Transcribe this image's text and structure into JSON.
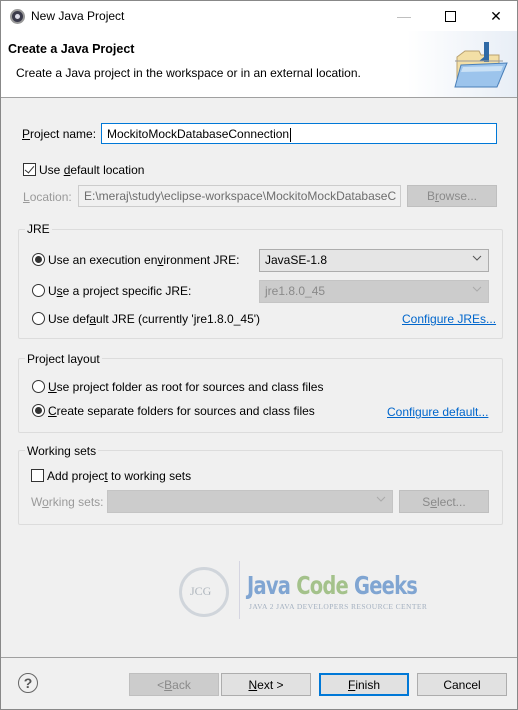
{
  "window": {
    "title": "New Java Project",
    "controls": {
      "minimize": "—",
      "maximize": "",
      "close": "✕"
    }
  },
  "header": {
    "title": "Create a Java Project",
    "description": "Create a Java project in the workspace or in an external location."
  },
  "project_name": {
    "label_prefix": "",
    "label_mnemonic": "P",
    "label_rest": "roject name:",
    "value": "MockitoMockDatabaseConnection"
  },
  "use_default_location": {
    "checked": true,
    "label_pre": "Use ",
    "label_mnemonic": "d",
    "label_rest": "efault location"
  },
  "location": {
    "label_mnemonic": "L",
    "label_rest": "ocation:",
    "value": "E:\\meraj\\study\\eclipse-workspace\\MockitoMockDatabaseC",
    "browse_pre": "B",
    "browse_mnemonic": "r",
    "browse_rest": "owse..."
  },
  "jre": {
    "group_label": "JRE",
    "options": [
      {
        "pre": "Use an execution en",
        "mnemonic": "v",
        "rest": "ironment JRE:",
        "selected": true
      },
      {
        "pre": "U",
        "mnemonic": "s",
        "rest": "e a project specific JRE:",
        "selected": false
      },
      {
        "pre": "Use def",
        "mnemonic": "a",
        "rest": "ult JRE (currently 'jre1.8.0_45')",
        "selected": false
      }
    ],
    "execution_env_value": "JavaSE-1.8",
    "project_jre_value": "jre1.8.0_45",
    "configure_link": "Configure JREs..."
  },
  "project_layout": {
    "group_label": "Project layout",
    "options": [
      {
        "mnemonic": "U",
        "rest": "se project folder as root for sources and class files",
        "selected": false
      },
      {
        "mnemonic": "C",
        "rest": "reate separate folders for sources and class files",
        "selected": true
      }
    ],
    "configure_link": "Configure default..."
  },
  "working_sets": {
    "group_label": "Working sets",
    "add_checked": false,
    "add_pre": "Add projec",
    "add_mnemonic": "t",
    "add_rest": " to working sets",
    "label_pre": "W",
    "label_mnemonic": "o",
    "label_rest": "rking sets:",
    "value": "",
    "select_pre": "S",
    "select_mnemonic": "e",
    "select_rest": "lect..."
  },
  "logo": {
    "java": "Java",
    "code": "Code",
    "geeks": "Geeks",
    "initials": "JCG",
    "tagline": "JAVA 2 JAVA DEVELOPERS RESOURCE CENTER"
  },
  "footer": {
    "help_icon": "?",
    "back_pre": "< ",
    "back_mnemonic": "B",
    "back_rest": "ack",
    "next_mnemonic": "N",
    "next_rest": "ext >",
    "finish_mnemonic": "F",
    "finish_rest": "inish",
    "cancel": "Cancel"
  }
}
